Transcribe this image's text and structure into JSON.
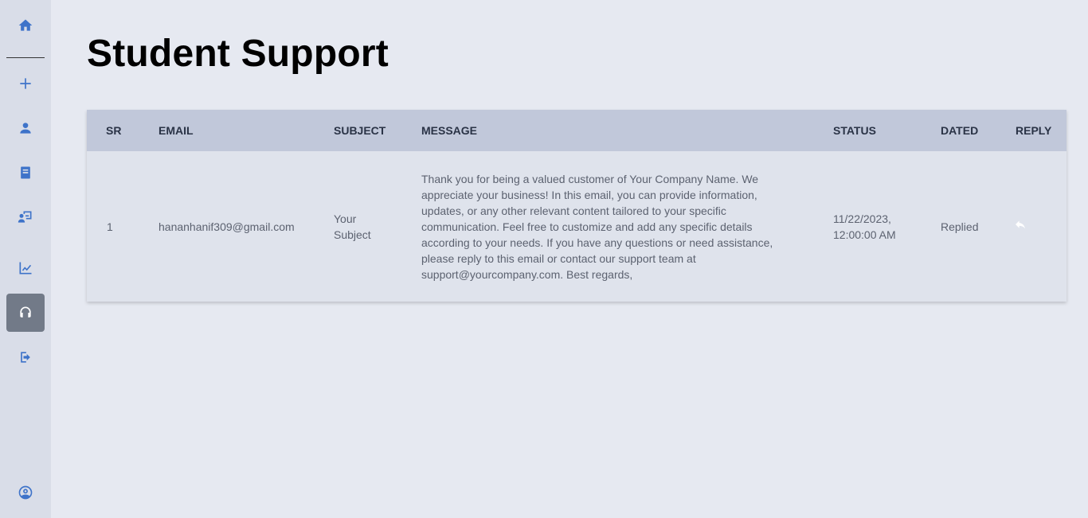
{
  "page": {
    "title": "Student Support"
  },
  "sidebar": {
    "items": [
      {
        "icon": "home-icon"
      },
      {
        "icon": "plus-icon"
      },
      {
        "icon": "user-icon"
      },
      {
        "icon": "book-icon"
      },
      {
        "icon": "teacher-board-icon"
      },
      {
        "icon": "chart-line-icon"
      },
      {
        "icon": "headset-icon",
        "active": true
      },
      {
        "icon": "logout-icon"
      },
      {
        "icon": "account-circle-icon"
      }
    ]
  },
  "table": {
    "headers": [
      "SR",
      "EMAIL",
      "SUBJECT",
      "MESSAGE",
      "STATUS",
      "DATED",
      "REPLY"
    ],
    "rows": [
      {
        "sr": "1",
        "email": "hananhanif309@gmail.com",
        "subject": "Your Subject",
        "message": "Thank you for being a valued customer of Your Company Name. We appreciate your business! In this email, you can provide information, updates, or any other relevant content tailored to your specific communication. Feel free to customize and add any specific details according to your needs. If you have any questions or need assistance, please reply to this email or contact our support team at support@yourcompany.com. Best regards,",
        "status": "11/22/2023, 12:00:00 AM",
        "dated": "Replied",
        "reply_icon": "reply-icon"
      }
    ]
  },
  "colors": {
    "accent": "#3e73c9",
    "sidebar_bg": "#d9dde8",
    "page_bg": "#e6e9f1",
    "header_bg": "#c1c8da",
    "active_nav_bg": "#727a88"
  }
}
